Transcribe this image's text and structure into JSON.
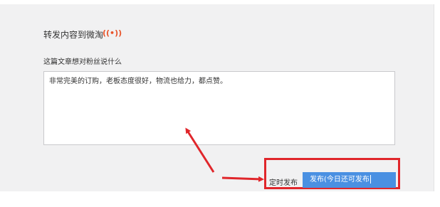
{
  "share": {
    "title": "转发内容到微淘",
    "icon": "radio-waves-icon",
    "icon_glyph": "((•))",
    "prompt_label": "这篇文章想对粉丝说什么",
    "message_text": "非常完美的订购，老板态度很好，物流也给力，都点赞。"
  },
  "actions": {
    "schedule_label": "定时发布",
    "publish_label": "发布(今日还可发布"
  },
  "colors": {
    "accent_blue": "#4a90e2",
    "annotation_red": "#e0262b",
    "icon_orange": "#e8532a",
    "panel_bg": "#f1f1f2"
  }
}
